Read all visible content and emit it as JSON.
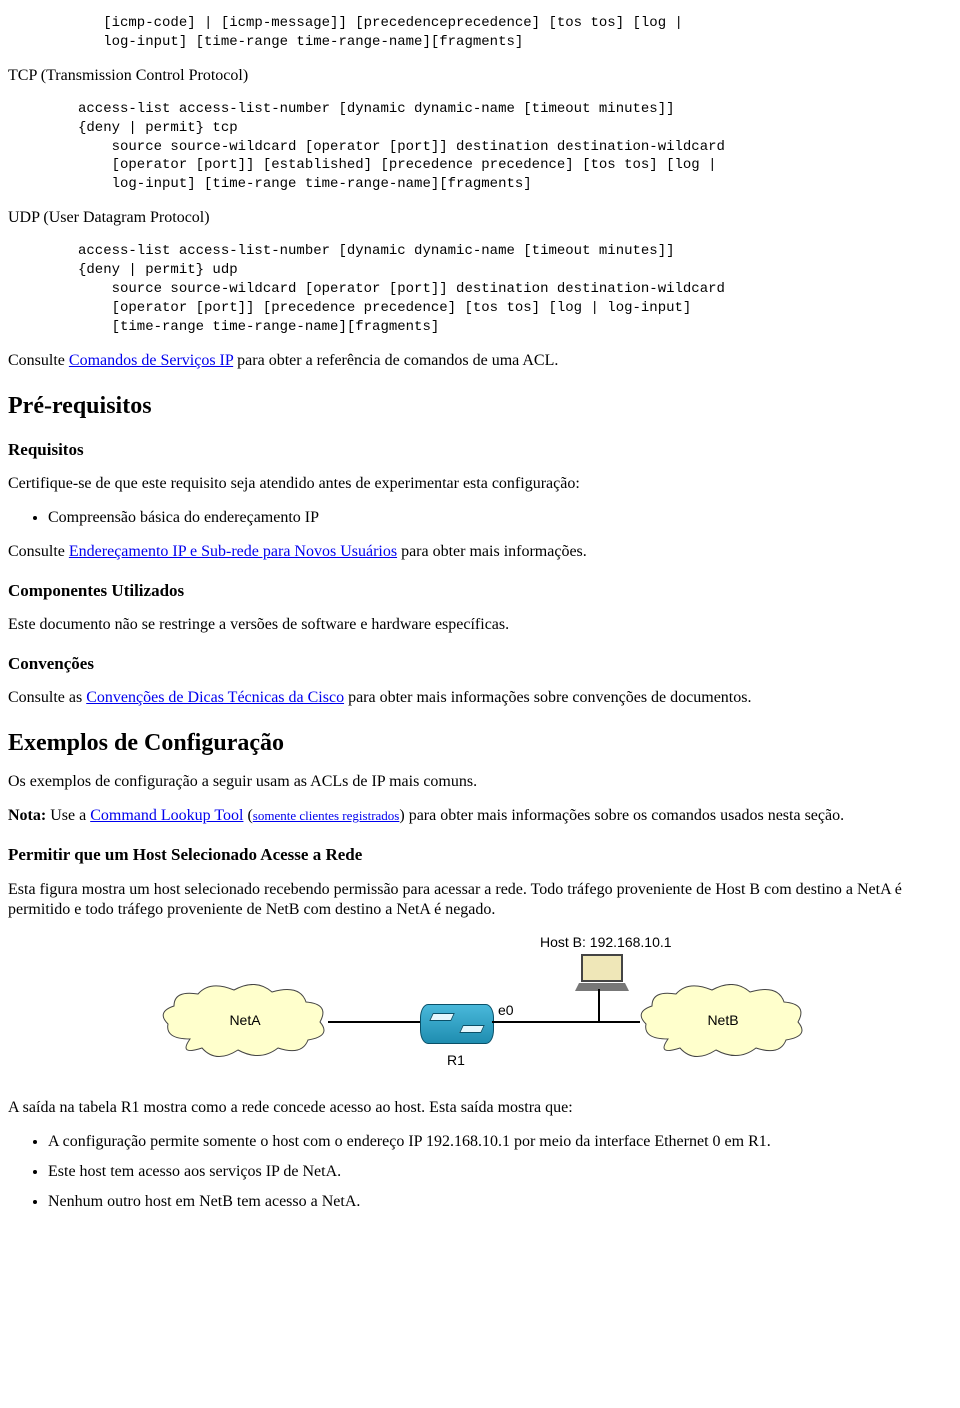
{
  "code_icmp_tail": "   [icmp-code] | [icmp-message]] [precedenceprecedence] [tos tos] [log |\n   log-input] [time-range time-range-name][fragments]",
  "p_tcp": "TCP (Transmission Control Protocol)",
  "code_tcp": "access-list access-list-number [dynamic dynamic-name [timeout minutes]]\n{deny | permit} tcp\n    source source-wildcard [operator [port]] destination destination-wildcard\n    [operator [port]] [established] [precedence precedence] [tos tos] [log |\n    log-input] [time-range time-range-name][fragments]",
  "p_udp": "UDP (User Datagram Protocol)",
  "code_udp": "access-list access-list-number [dynamic dynamic-name [timeout minutes]]\n{deny | permit} udp\n    source source-wildcard [operator [port]] destination destination-wildcard\n    [operator [port]] [precedence precedence] [tos tos] [log | log-input]\n    [time-range time-range-name][fragments]",
  "p_consulte_prefix": "Consulte ",
  "link_comandos": "Comandos de Serviços IP",
  "p_consulte_suffix": " para obter a referência de comandos de uma ACL.",
  "h_prereq": "Pré-requisitos",
  "h_requisitos": "Requisitos",
  "p_certifique": "Certifique-se de que este requisito seja atendido antes de experimentar esta configuração:",
  "li_compreensao": "Compreensão básica do endereçamento IP",
  "p_enderecamento_prefix": "Consulte ",
  "link_enderecamento": "Endereçamento IP e Sub-rede para Novos Usuários",
  "p_enderecamento_suffix": " para obter mais informações.",
  "h_componentes": "Componentes Utilizados",
  "p_componentes": "Este documento não se restringe a versões de software e hardware específicas.",
  "h_convencoes": "Convenções",
  "p_convencoes_prefix": "Consulte as ",
  "link_convencoes": "Convenções de Dicas Técnicas da Cisco",
  "p_convencoes_suffix": " para obter mais informações sobre convenções de documentos.",
  "h_exemplos": "Exemplos de Configuração",
  "p_exemplos_intro": "Os exemplos de configuração a seguir usam as ACLs de IP mais comuns.",
  "nota_bold": "Nota:",
  "nota_p1": " Use a ",
  "link_clt": "Command Lookup Tool",
  "nota_p2": " (",
  "link_clientes": "somente clientes registrados",
  "nota_p3": ") para obter mais informações sobre os comandos usados nesta seção.",
  "h_permitir": "Permitir que um Host Selecionado Acesse a Rede",
  "p_permitir": "Esta figura mostra um host selecionado recebendo permissão para acessar a rede. Todo tráfego proveniente de Host B com destino a NetA é permitido e todo tráfego proveniente de NetB com destino a NetA é negado.",
  "diagram": {
    "hostb": "Host B: 192.168.10.1",
    "neta": "NetA",
    "netb": "NetB",
    "e0": "e0",
    "r1": "R1"
  },
  "p_saida_intro": "A saída na tabela R1 mostra como a rede concede acesso ao host. Esta saída mostra que:",
  "li_conf1": "A configuração permite somente o host com o endereço IP 192.168.10.1 por meio da interface Ethernet 0 em R1.",
  "li_conf2": "Este host tem acesso aos serviços IP de NetA.",
  "li_conf3": "Nenhum outro host em NetB tem acesso a NetA."
}
